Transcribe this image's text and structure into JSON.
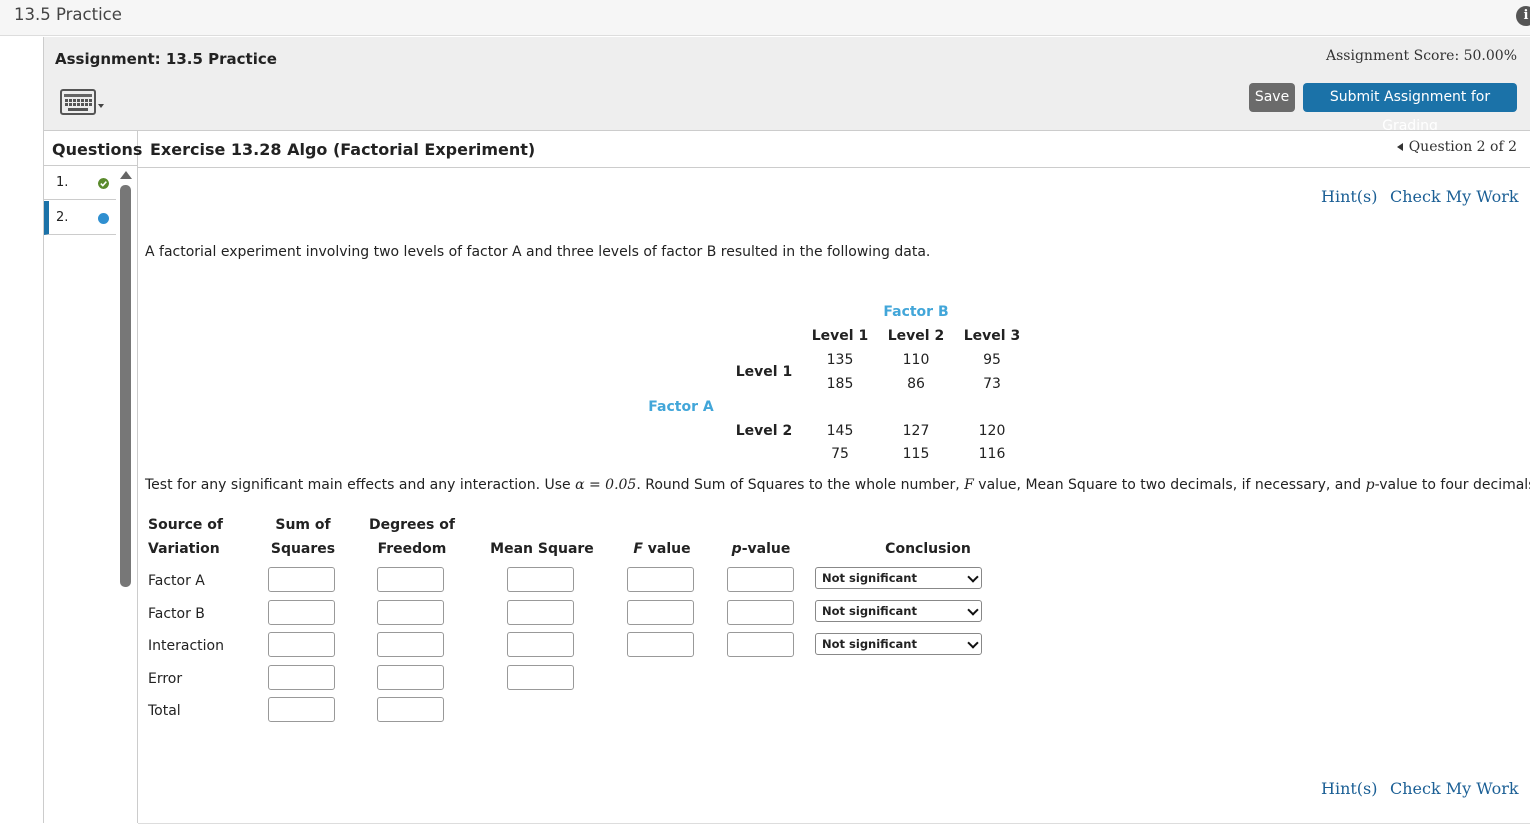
{
  "topbar": {
    "title": "13.5 Practice",
    "info_icon": "i"
  },
  "assignment": {
    "title": "Assignment: 13.5 Practice",
    "score": "Assignment Score: 50.00%",
    "keyboard_icon": "keyboard-icon",
    "save_label": "Save",
    "submit_label": "Submit Assignment for Grading"
  },
  "questions": {
    "header": "Questions",
    "items": [
      {
        "num": "1.",
        "status": "complete",
        "color": "#5a8a2c"
      },
      {
        "num": "2.",
        "status": "current",
        "color": "#1b72a8"
      }
    ]
  },
  "exercise": {
    "title": "Exercise 13.28 Algo (Factorial Experiment)",
    "nav": "Question 2 of 2",
    "hints_label": "Hint(s)",
    "check_label": "Check My Work",
    "intro": "A factorial experiment involving two levels of factor A and three levels of factor B resulted in the following data.",
    "instructions": {
      "pre": "Test for any significant main effects and any interaction. Use ",
      "alpha": "α = 0.05",
      "mid": ". Round Sum of Squares to the whole number, ",
      "F": "F",
      "mid2": " value, Mean Square to two decimals, if necessary, and ",
      "p": "p",
      "post": "-value to four decimals."
    }
  },
  "data_table": {
    "factor_b_label": "Factor B",
    "factor_a_label": "Factor A",
    "b_levels": [
      "Level 1",
      "Level 2",
      "Level 3"
    ],
    "a_levels": [
      {
        "label": "Level 1",
        "rows": [
          [
            "135",
            "110",
            "95"
          ],
          [
            "185",
            "86",
            "73"
          ]
        ]
      },
      {
        "label": "Level 2",
        "rows": [
          [
            "145",
            "127",
            "120"
          ],
          [
            "75",
            "115",
            "116"
          ]
        ]
      }
    ]
  },
  "anova": {
    "headers": {
      "source_1": "Source of",
      "source_2": "Variation",
      "ss_1": "Sum of",
      "ss_2": "Squares",
      "df_1": "Degrees of",
      "df_2": "Freedom",
      "ms": "Mean Square",
      "f_var": "F",
      "f_rest": " value",
      "p_var": "p",
      "p_rest": "-value",
      "conclusion": "Conclusion"
    },
    "rows": [
      {
        "label": "Factor A",
        "conclusion": "Not significant"
      },
      {
        "label": "Factor B",
        "conclusion": "Not significant"
      },
      {
        "label": "Interaction",
        "conclusion": "Not significant"
      },
      {
        "label": "Error"
      },
      {
        "label": "Total"
      }
    ]
  }
}
